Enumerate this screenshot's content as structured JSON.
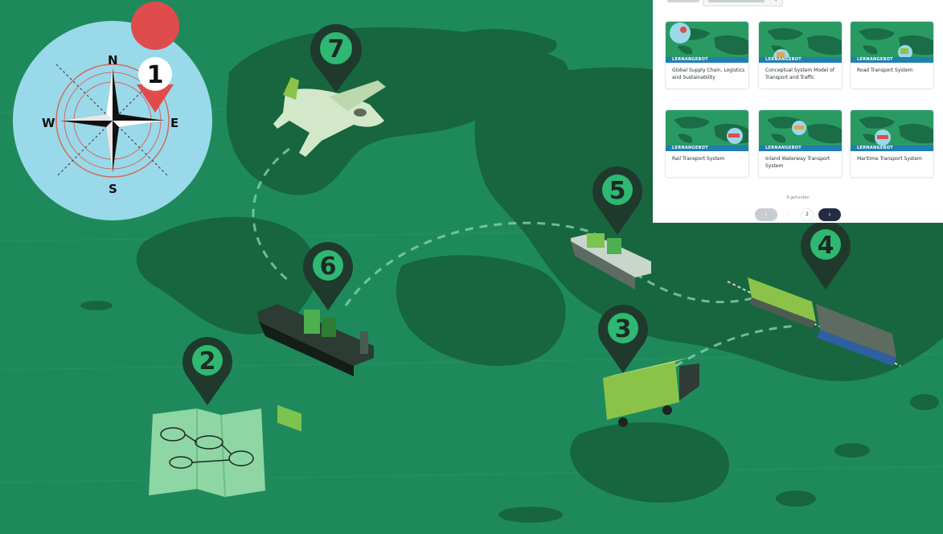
{
  "map": {
    "compass_letters": {
      "north": "N",
      "east": "E",
      "south": "S",
      "west": "W"
    },
    "pins": [
      {
        "id": "pin-1",
        "label": "1"
      },
      {
        "id": "pin-2",
        "label": "2"
      },
      {
        "id": "pin-3",
        "label": "3"
      },
      {
        "id": "pin-4",
        "label": "4"
      },
      {
        "id": "pin-5",
        "label": "5"
      },
      {
        "id": "pin-6",
        "label": "6"
      },
      {
        "id": "pin-7",
        "label": "7"
      }
    ],
    "colors": {
      "ocean": "#1e8a5c",
      "land": "#17663f",
      "pin": "#1f3a2c",
      "pin_accent": "#e04b4b",
      "compass_bg": "#9ad9ea"
    }
  },
  "panel": {
    "cards": [
      {
        "badge": "LERNANGEBOT",
        "title": "Global Supply Chain, Logistics and Sustainability"
      },
      {
        "badge": "LERNANGEBOT",
        "title": "Conceptual System Model of Transport and Traffic"
      },
      {
        "badge": "LERNANGEBOT",
        "title": "Road Transport System"
      },
      {
        "badge": "LERNANGEBOT",
        "title": "Rail Transport System"
      },
      {
        "badge": "LERNANGEBOT",
        "title": "Inland Waterway Transport System"
      },
      {
        "badge": "LERNANGEBOT",
        "title": "Maritime Transport System"
      }
    ],
    "results_count": "9 gefunden",
    "pagination": {
      "prev": "‹",
      "dot": "‹",
      "page": "2",
      "next": "›"
    },
    "colors": {
      "badge": "#1f7fae",
      "next_button": "#262b45"
    }
  }
}
